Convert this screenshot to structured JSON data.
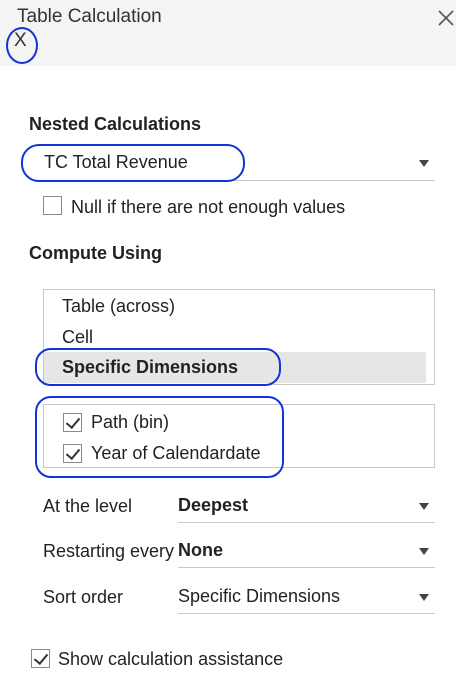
{
  "dialog": {
    "title": "Table Calculation",
    "title_x": "X"
  },
  "nested": {
    "heading": "Nested Calculations",
    "selected": "TC Total Revenue",
    "null_option_label": "Null if there are not enough values",
    "null_option_checked": false
  },
  "compute": {
    "heading": "Compute Using",
    "options": [
      "Table (across)",
      "Cell",
      "Specific Dimensions"
    ],
    "selected_index": 2,
    "dimensions": [
      {
        "label": "Path (bin)",
        "checked": true
      },
      {
        "label": "Year of Calendardate",
        "checked": true
      }
    ]
  },
  "settings": {
    "level": {
      "label": "At the level",
      "value": "Deepest"
    },
    "restart": {
      "label": "Restarting every",
      "value": "None"
    },
    "sort": {
      "label": "Sort order",
      "value": "Specific Dimensions"
    }
  },
  "assistance": {
    "label": "Show calculation assistance",
    "checked": true
  },
  "colors": {
    "highlight_ring": "#1433d6",
    "selected_row": "#e6e6e6"
  },
  "icons": [
    "close-icon",
    "caret-down-icon",
    "checkbox-icon"
  ]
}
